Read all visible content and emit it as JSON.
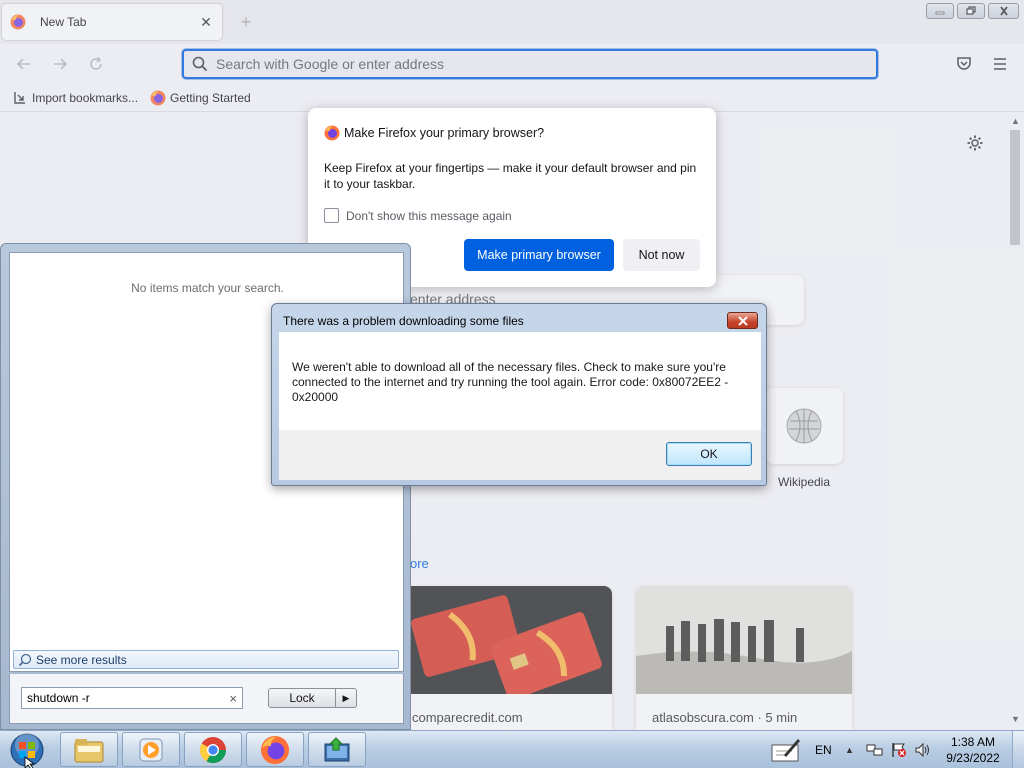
{
  "browser": {
    "tab_title": "New Tab",
    "new_tab_symbol": "+",
    "close_symbol": "✕",
    "url_placeholder": "Search with Google or enter address",
    "bookmarks": {
      "import": "Import bookmarks...",
      "getting_started": "Getting Started"
    },
    "icons": [
      "firefox-logo-icon",
      "back-arrow-icon",
      "forward-arrow-icon",
      "reload-icon",
      "search-icon",
      "pocket-icon",
      "hamburger-menu-icon",
      "settings-gear-icon"
    ]
  },
  "newtab": {
    "search_hint": "enter address",
    "topsite_label": "Wikipedia",
    "more_link": "ore",
    "stories": [
      {
        "source": "comparecredit.com"
      },
      {
        "source": "atlasobscura.com · 5 min"
      }
    ]
  },
  "ff_modal": {
    "title": "Make Firefox your primary browser?",
    "body": "Keep Firefox at your fingertips — make it your default browser and pin it to your taskbar.",
    "checkbox_label": "Don't show this message again",
    "primary_button": "Make primary browser",
    "secondary_button": "Not now"
  },
  "start_menu": {
    "no_items": "No items match your search.",
    "see_more": "See more results",
    "search_value": "shutdown -r",
    "clear_symbol": "×",
    "lock_label": "Lock",
    "lock_arrow": "▶"
  },
  "error_dialog": {
    "title": "There was a problem downloading some files",
    "message": "We weren't able to download all of the necessary files. Check to make sure you're connected to the internet and try running the tool again. Error code: 0x80072EE2 - 0x20000",
    "ok_label": "OK"
  },
  "taskbar": {
    "language": "EN",
    "tray_chevron": "▲",
    "time": "1:38 AM",
    "date": "9/23/2022"
  },
  "colors": {
    "firefox_blue": "#0061e0",
    "taskbar": "#b9cde3",
    "dialog_frame": "#c6d6ea"
  }
}
